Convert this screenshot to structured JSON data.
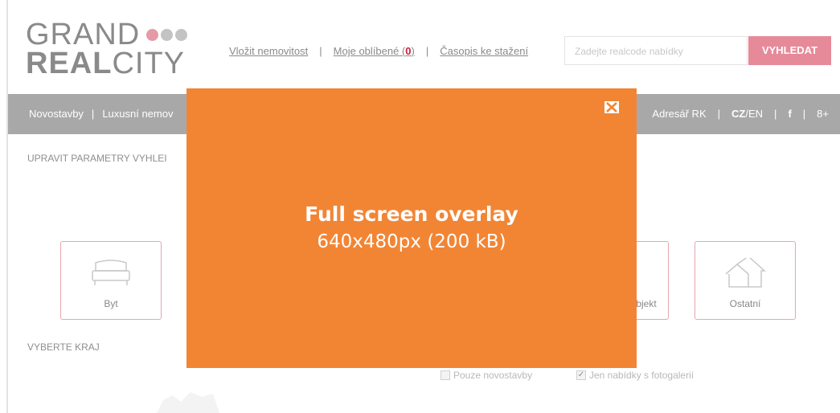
{
  "logo": {
    "line1": "GRAND",
    "line2_bold": "REAL",
    "line2_thin": "CITY"
  },
  "toplinks": {
    "insert": "Vložit nemovitost",
    "sep": "|",
    "favorites": "Moje oblíbené",
    "favorites_open": "(",
    "favorites_count": "0",
    "favorites_close": ")",
    "magazine": "Časopis ke stažení"
  },
  "search": {
    "placeholder": "Zadejte realcode nabídky",
    "button": "VYHLEDAT"
  },
  "nav": {
    "left": [
      "Novostavby",
      "|",
      "Luxusní nemov"
    ],
    "right": {
      "agents": "Adresář RK",
      "sep": "|",
      "lang_active": "CZ",
      "lang_sep": "/",
      "lang_other": "EN",
      "facebook": "f",
      "gplus": "8+"
    }
  },
  "sections": {
    "params": "UPRAVIT PARAMETRY VYHLEI",
    "region": "VYBERTE KRAJ"
  },
  "tiles": {
    "byt": "Byt",
    "objekt": "bjekt",
    "ostatni": "Ostatní"
  },
  "checkboxes": {
    "novostavby": "Pouze novostavby",
    "foto": "Jen nabídky s fotogalerií",
    "foto_check": "✓"
  },
  "overlay": {
    "title": "Full screen overlay",
    "subtitle": "640x480px (200 kB)"
  },
  "colors": {
    "accent": "#e68a99",
    "overlay": "#f28534",
    "nav": "#a8a8a8",
    "highlight": "#c9213b"
  }
}
